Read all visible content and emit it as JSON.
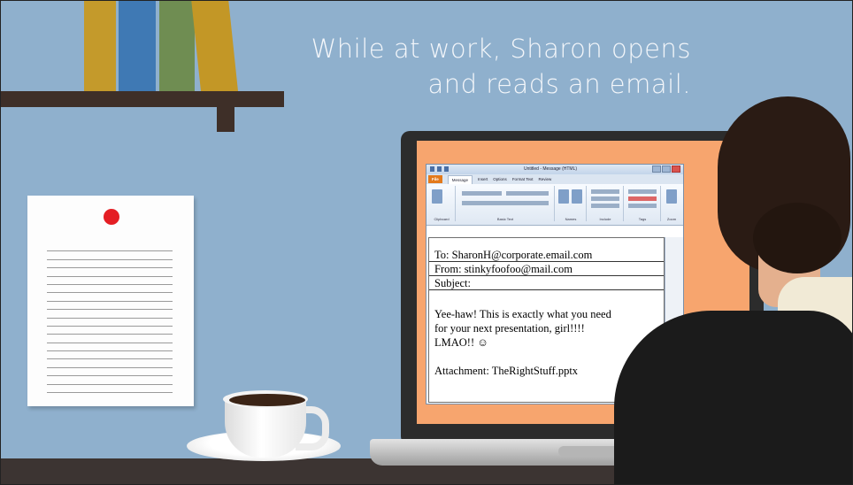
{
  "headline": {
    "line1": "While at work, Sharon opens",
    "line2": "and reads an email."
  },
  "colors": {
    "wall": "#8fb0cd",
    "screen": "#f7a56e",
    "desk": "#3c3432",
    "pin": "#e41e24",
    "books": [
      "#c49a2b",
      "#3f79b4",
      "#6f8d52",
      "#c39726"
    ]
  },
  "email_window": {
    "title": "Untitled - Message (HTML)",
    "tabs": [
      "File",
      "Message",
      "Insert",
      "Options",
      "Format Text",
      "Review"
    ],
    "ribbon_groups": [
      "Clipboard",
      "Basic Text",
      "Names",
      "Include",
      "Tags",
      "Zoom"
    ],
    "to_label": "To:",
    "to": "SharonH@corporate.email.com",
    "from_label": "From:",
    "from": "stinkyfoofoo@mail.com",
    "subject_label": "Subject:",
    "subject": "",
    "body_line1": "Yee-haw! This is exactly what you need",
    "body_line2": "for your next presentation, girl!!!!",
    "body_line3": "LMAO!! ☺",
    "attachment_label": "Attachment:",
    "attachment": "TheRightStuff.pptx"
  }
}
